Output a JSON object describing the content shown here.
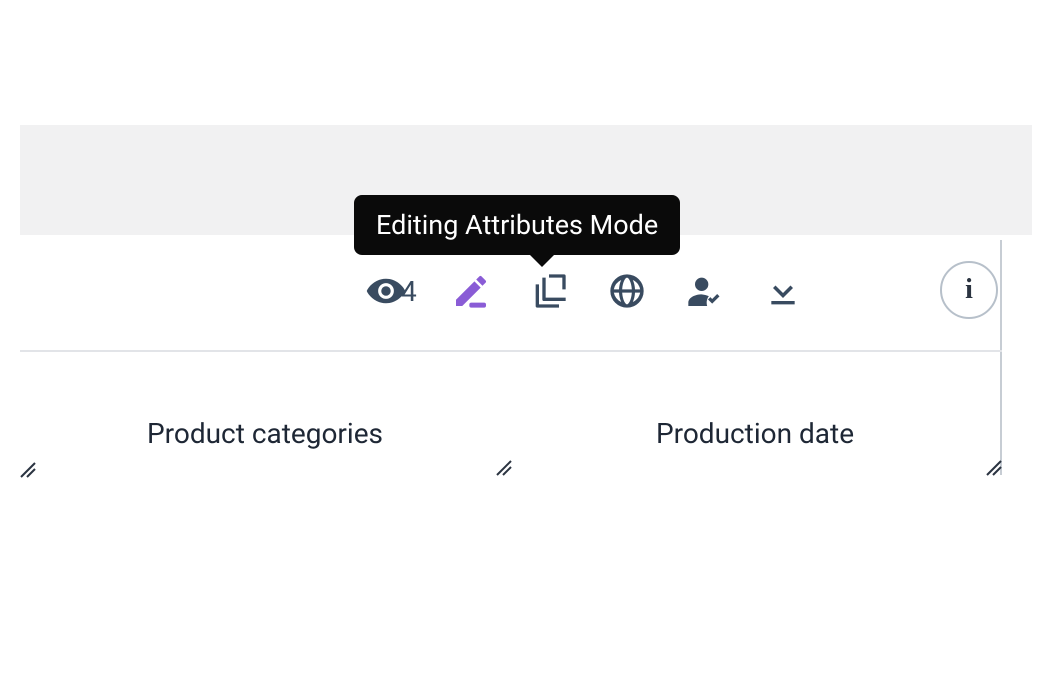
{
  "tooltip": {
    "text": "Editing Attributes Mode"
  },
  "toolbar": {
    "view_count": "4",
    "info_label": "i"
  },
  "columns": {
    "col1": "Product categories",
    "col2": "Production date"
  }
}
